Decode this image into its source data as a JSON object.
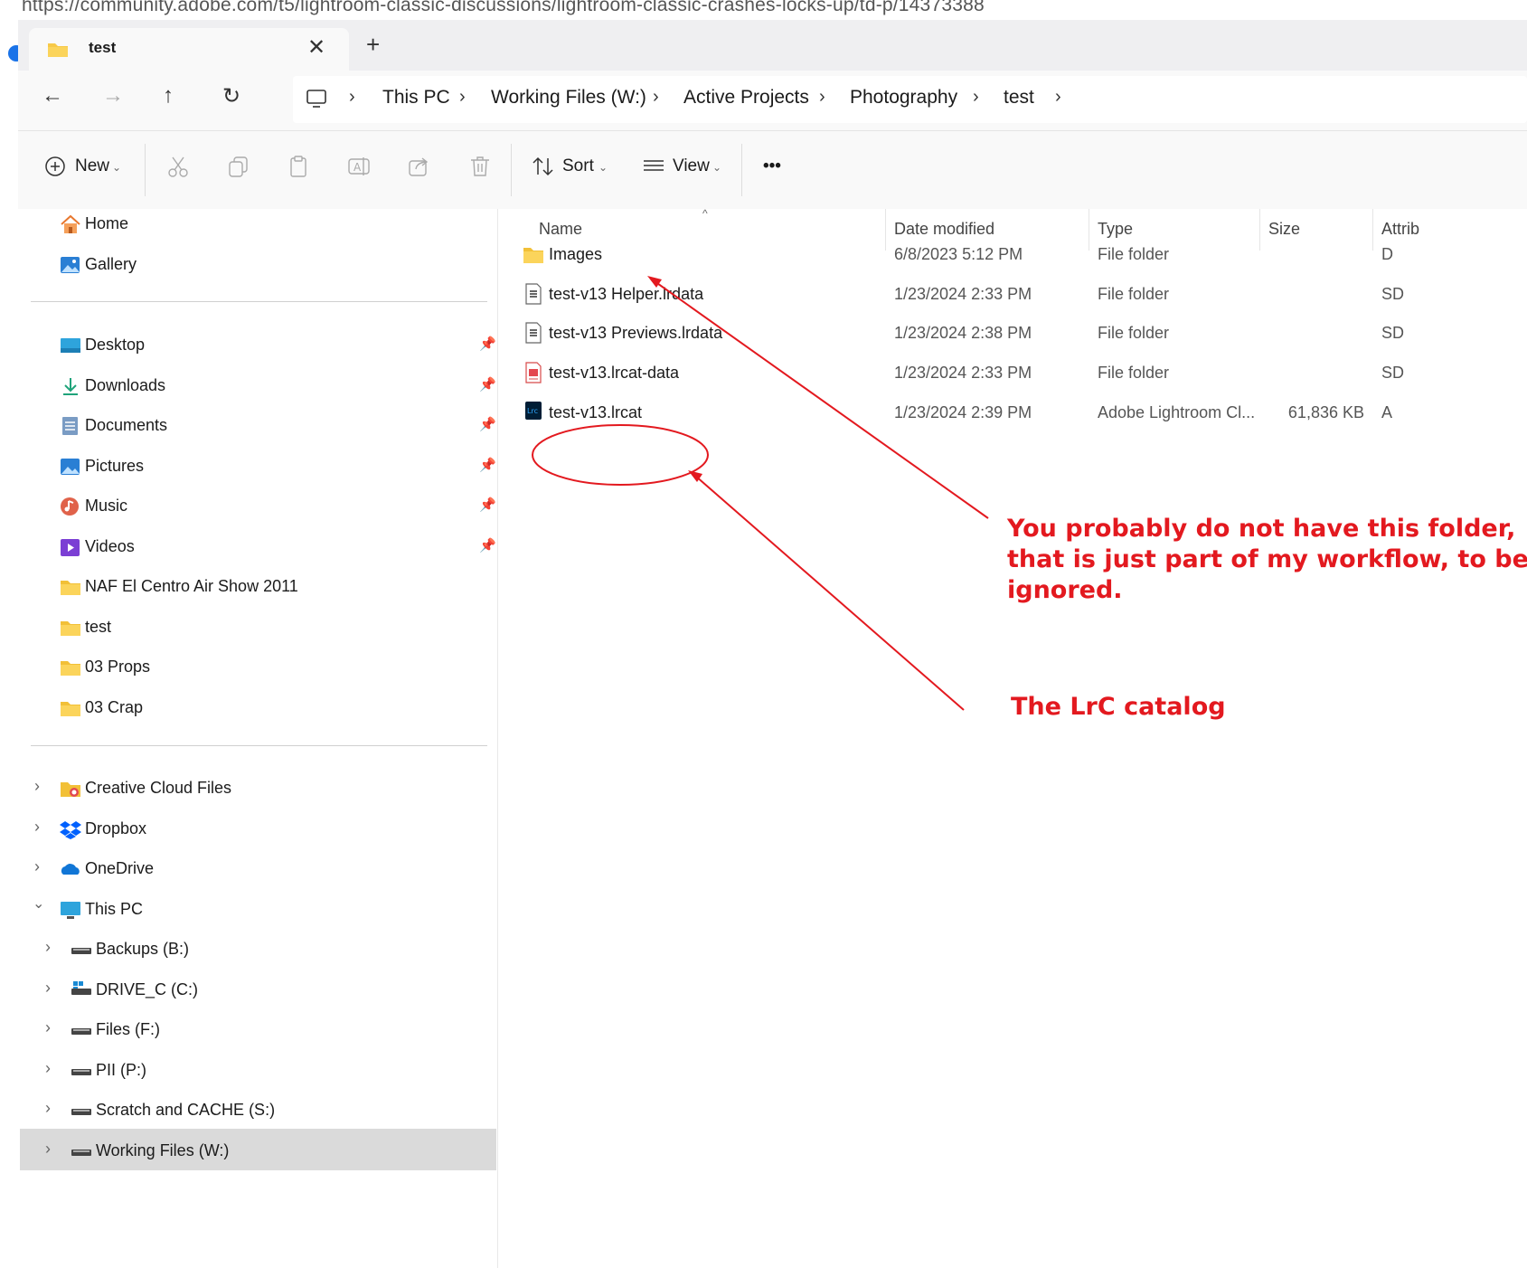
{
  "browser": {
    "url": "https://community.adobe.com/t5/lightroom-classic-discussions/lightroom-classic-crashes-locks-up/td-p/14373388"
  },
  "tab": {
    "title": "test",
    "close_icon": "close-icon",
    "new_tab_icon": "plus-icon"
  },
  "nav": {
    "breadcrumbs": [
      "This PC",
      "Working Files (W:)",
      "Active Projects",
      "Photography",
      "test"
    ]
  },
  "toolbar": {
    "new_label": "New",
    "sort_label": "Sort",
    "view_label": "View",
    "more_label": "•••"
  },
  "sidebar": {
    "quick": [
      {
        "label": "Home",
        "icon": "home-icon"
      },
      {
        "label": "Gallery",
        "icon": "gallery-icon"
      }
    ],
    "pinned": [
      {
        "label": "Desktop",
        "icon": "desktop-icon"
      },
      {
        "label": "Downloads",
        "icon": "downloads-icon"
      },
      {
        "label": "Documents",
        "icon": "documents-icon"
      },
      {
        "label": "Pictures",
        "icon": "pictures-icon"
      },
      {
        "label": "Music",
        "icon": "music-icon"
      },
      {
        "label": "Videos",
        "icon": "videos-icon"
      },
      {
        "label": "NAF El Centro Air Show 2011",
        "icon": "folder-icon"
      },
      {
        "label": "test",
        "icon": "folder-icon"
      },
      {
        "label": "03 Props",
        "icon": "folder-icon"
      },
      {
        "label": "03 Crap",
        "icon": "folder-icon"
      }
    ],
    "locations": [
      {
        "label": "Creative Cloud Files",
        "icon": "creative-cloud-icon"
      },
      {
        "label": "Dropbox",
        "icon": "dropbox-icon"
      },
      {
        "label": "OneDrive",
        "icon": "onedrive-icon"
      },
      {
        "label": "This PC",
        "icon": "this-pc-icon"
      }
    ],
    "drives": [
      {
        "label": "Backups (B:)"
      },
      {
        "label": "DRIVE_C (C:)"
      },
      {
        "label": "Files (F:)"
      },
      {
        "label": "PII (P:)"
      },
      {
        "label": "Scratch and CACHE (S:)"
      },
      {
        "label": "Working Files (W:)"
      }
    ]
  },
  "columns": {
    "name": "Name",
    "date": "Date modified",
    "type": "Type",
    "size": "Size",
    "attrib": "Attrib"
  },
  "files": [
    {
      "name": "Images",
      "date": "6/8/2023 5:12 PM",
      "type": "File folder",
      "size": "",
      "attrib": "D",
      "icon": "folder-icon"
    },
    {
      "name": "test-v13 Helper.lrdata",
      "date": "1/23/2024 2:33 PM",
      "type": "File folder",
      "size": "",
      "attrib": "SD",
      "icon": "lrdata-icon"
    },
    {
      "name": "test-v13 Previews.lrdata",
      "date": "1/23/2024 2:38 PM",
      "type": "File folder",
      "size": "",
      "attrib": "SD",
      "icon": "lrdata-icon"
    },
    {
      "name": "test-v13.lrcat-data",
      "date": "1/23/2024 2:33 PM",
      "type": "File folder",
      "size": "",
      "attrib": "SD",
      "icon": "lrcat-data-icon"
    },
    {
      "name": "test-v13.lrcat",
      "date": "1/23/2024 2:39 PM",
      "type": "Adobe Lightroom Cl...",
      "size": "61,836 KB",
      "attrib": "A",
      "icon": "lightroom-catalog-icon"
    }
  ],
  "annotations": {
    "note1_line1": "You probably do not have this folder,",
    "note1_line2": "that is just part of my workflow, to be",
    "note1_line3": "ignored.",
    "note2": "The LrC catalog",
    "color": "#e3191f"
  }
}
